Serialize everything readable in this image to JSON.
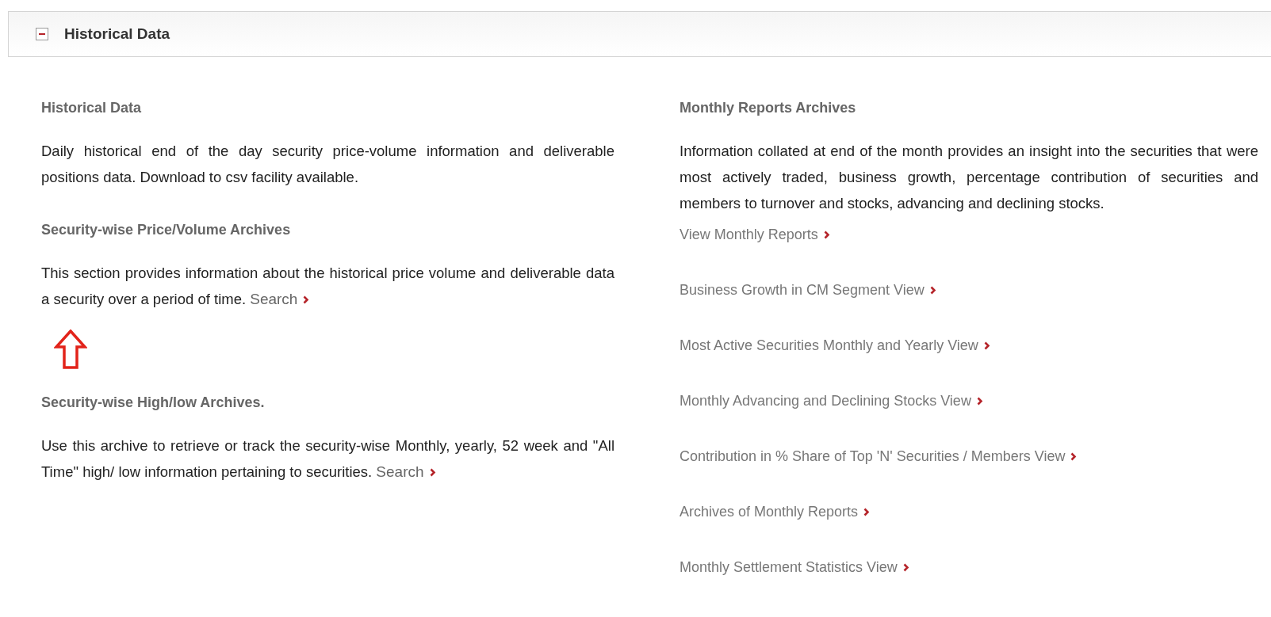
{
  "panel": {
    "title": "Historical Data",
    "expanded": true
  },
  "left_sections": [
    {
      "heading": "Historical Data",
      "text": "Daily historical end of the day security price-volume information and deliverable positions data. Download to csv facility available."
    },
    {
      "heading": "Security-wise Price/Volume Archives",
      "text": "This section provides information about the historical price volume and deliverable data a security over a period of time.",
      "link": "Search",
      "annotated": true
    },
    {
      "heading": "Security-wise High/low Archives.",
      "text": "Use this archive to retrieve or track the security-wise Monthly, yearly, 52 week and \"All Time\" high/ low information pertaining to securities.",
      "link": "Search",
      "annotated": false
    }
  ],
  "right_section": {
    "heading": "Monthly Reports Archives",
    "text": "Information collated at end of the month provides an insight into the securities that were most actively traded, business growth, percentage contribution of securities and members to turnover and stocks, advancing and declining stocks.",
    "links": [
      "View Monthly Reports",
      "Business Growth in CM Segment View",
      "Most Active Securities Monthly and Yearly View",
      "Monthly Advancing and Declining Stocks View",
      "Contribution in % Share of Top 'N' Securities / Members View",
      "Archives of Monthly Reports",
      "Monthly Settlement Statistics View"
    ]
  }
}
